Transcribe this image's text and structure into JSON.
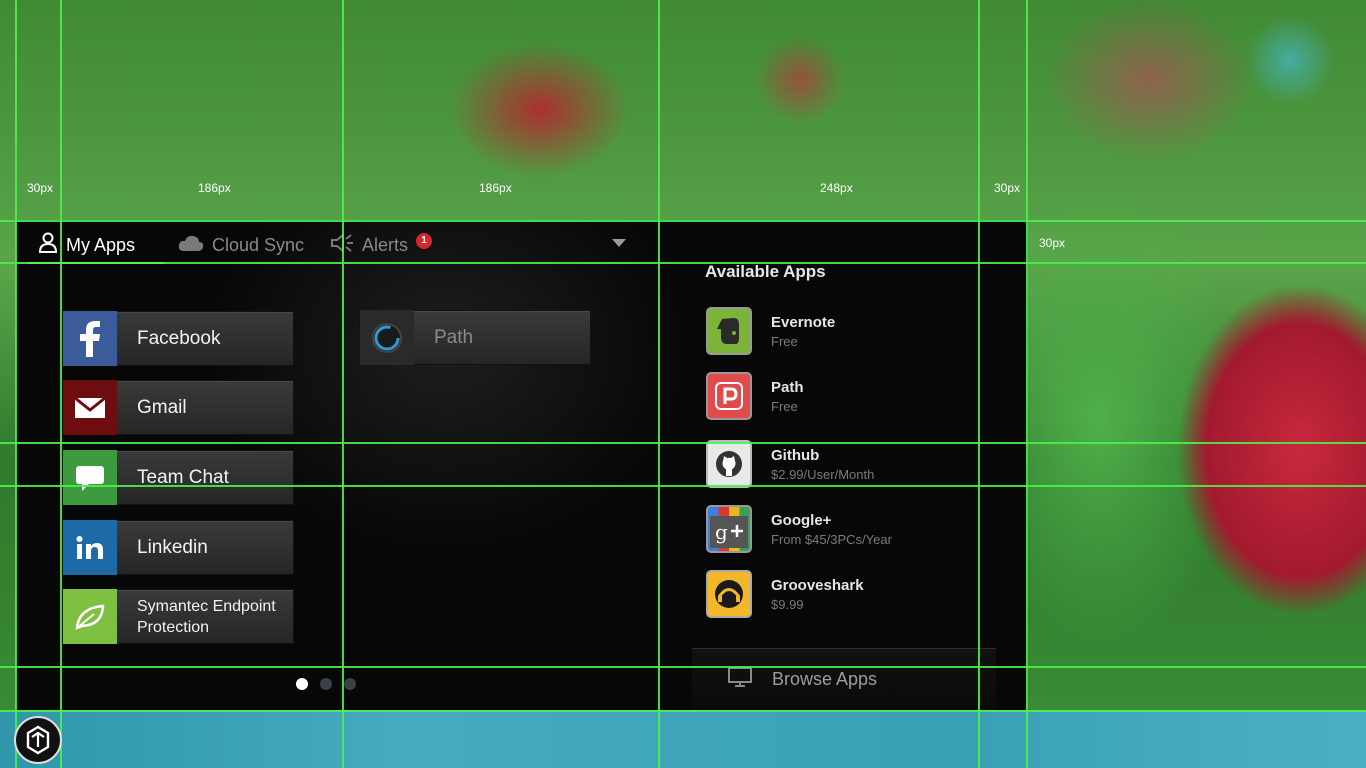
{
  "colors": {
    "guide": "#4cef4c",
    "alert_badge": "#d6262c",
    "dock": "#3aa2b8",
    "panel": "#070707"
  },
  "guide_labels": {
    "l1": "30px",
    "l2": "186px",
    "l3": "186px",
    "l4": "248px",
    "l5": "30px",
    "l6": "30px"
  },
  "tabs": [
    {
      "label": "My Apps",
      "icon": "user-icon",
      "active": true
    },
    {
      "label": "Cloud Sync",
      "icon": "cloud-icon",
      "active": false
    },
    {
      "label": "Alerts",
      "icon": "speaker-icon",
      "active": false,
      "badge": "1"
    }
  ],
  "my_apps": [
    {
      "label": "Facebook",
      "icon": "facebook-icon",
      "color": "#3b5b9a"
    },
    {
      "label": "Gmail",
      "icon": "envelope-icon",
      "color": "#6e0d10"
    },
    {
      "label": "Team Chat",
      "icon": "chat-bubble-icon",
      "color": "#3d9a3f"
    },
    {
      "label": "Linkedin",
      "icon": "linkedin-icon",
      "color": "#1c6ba8"
    },
    {
      "label": "Symantec Endpoint Protection",
      "icon": "leaf-icon",
      "color": "#7ec041"
    },
    {
      "label": "Path",
      "icon": "path-ring-icon",
      "color": "#2a2a2a"
    }
  ],
  "pager": {
    "pages": 3,
    "current": 1
  },
  "available": {
    "title": "Available Apps",
    "items": [
      {
        "name": "Evernote",
        "price": "Free",
        "icon": "evernote-icon",
        "color": "#7ab53a"
      },
      {
        "name": "Path",
        "price": "Free",
        "icon": "path-p-icon",
        "color": "#e04a4a"
      },
      {
        "name": "Github",
        "price": "$2.99/User/Month",
        "icon": "github-icon",
        "color": "#e8e8e8"
      },
      {
        "name": "Google+",
        "price": "From $45/3PCs/Year",
        "icon": "google-plus-icon",
        "color": "#555555"
      },
      {
        "name": "Grooveshark",
        "price": "$9.99",
        "icon": "grooveshark-icon",
        "color": "#f2b82a"
      }
    ],
    "browse_label": "Browse Apps"
  }
}
